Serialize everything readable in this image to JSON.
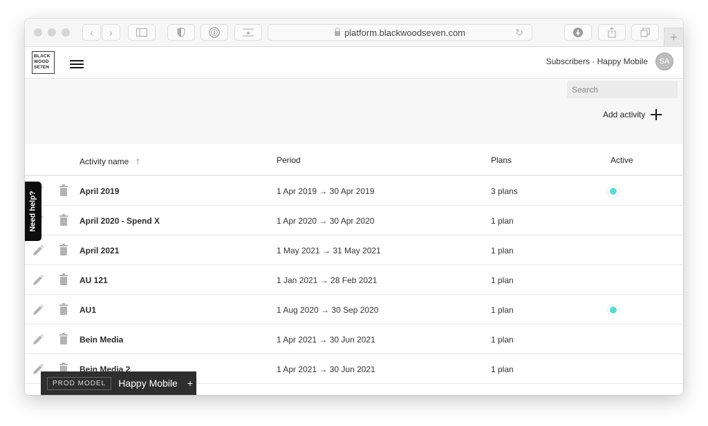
{
  "browser": {
    "url": "platform.blackwoodseven.com",
    "icons": [
      "back-icon",
      "forward-icon",
      "sidebar-icon",
      "shield-icon",
      "password-icon",
      "bookmark-icon",
      "download-icon",
      "share-icon",
      "tabs-icon",
      "new-tab-icon"
    ]
  },
  "header": {
    "logo_lines": [
      "BLACK",
      "WOOD",
      "SE7EN"
    ],
    "account_text": "Subscribers · Happy Mobile",
    "avatar_initials": "SA"
  },
  "controls": {
    "search_placeholder": "Search",
    "add_activity_label": "Add activity"
  },
  "table": {
    "columns": {
      "name": "Activity name",
      "period": "Period",
      "plans": "Plans",
      "active": "Active"
    },
    "sort_indicator": "↑",
    "rows": [
      {
        "name": "April 2019",
        "period": "1 Apr 2019 → 30 Apr 2019",
        "plans": "3 plans",
        "active": true
      },
      {
        "name": "April 2020 - Spend X",
        "period": "1 Apr 2020 → 30 Apr 2020",
        "plans": "1 plan",
        "active": false
      },
      {
        "name": "April 2021",
        "period": "1 May 2021 → 31 May 2021",
        "plans": "1 plan",
        "active": false
      },
      {
        "name": "AU 121",
        "period": "1 Jan 2021 → 28 Feb 2021",
        "plans": "1 plan",
        "active": false
      },
      {
        "name": "AU1",
        "period": "1 Aug 2020 → 30 Sep 2020",
        "plans": "1 plan",
        "active": true
      },
      {
        "name": "Bein Media",
        "period": "1 Apr 2021 → 30 Jun 2021",
        "plans": "1 plan",
        "active": false
      },
      {
        "name": "Bein Media 2",
        "period": "1 Apr 2021 → 30 Jun 2021",
        "plans": "1 plan",
        "active": false
      }
    ]
  },
  "help_tab": {
    "label": "Need help?"
  },
  "prod_bar": {
    "badge": "PROD MODEL",
    "name": "Happy Mobile",
    "plus": "+"
  },
  "colors": {
    "active_dot": "#5fd8d0",
    "prod_bar_bg": "#2e2e2e"
  }
}
